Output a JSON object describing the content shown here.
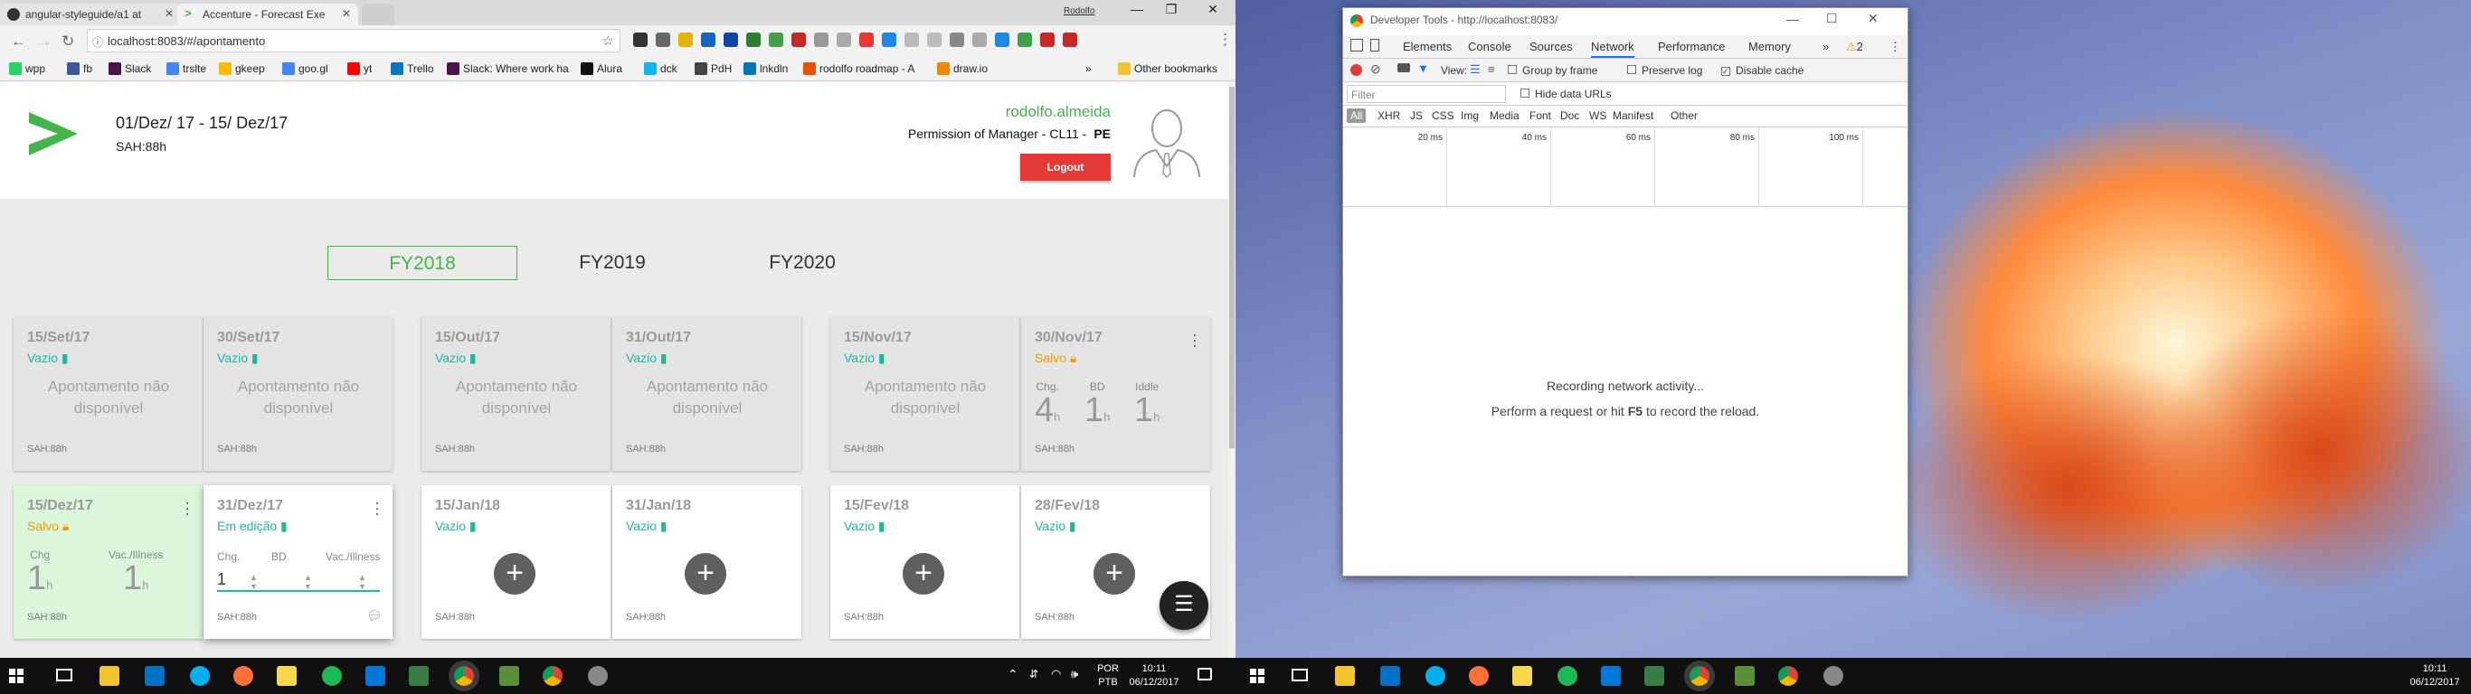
{
  "browser": {
    "tabs": [
      {
        "label": "angular-styleguide/a1 at"
      },
      {
        "label": "Accenture - Forecast Exe"
      }
    ],
    "user_label": "Rodolfo",
    "url": "localhost:8083/#/apontamento",
    "bookmarks": [
      "wpp",
      "fb",
      "Slack",
      "trslte",
      "gkeep",
      "goo.gl",
      "yt",
      "Trello",
      "Slack: Where work ha",
      "Alura",
      "dck",
      "PdH",
      "lnkdln",
      "rodolfo roadmap - A",
      "draw.io"
    ],
    "bookmarks_overflow": "»",
    "other_bookmarks": "Other bookmarks"
  },
  "header": {
    "date_range": "01/Dez/ 17 - 15/ Dez/17",
    "sah": "SAH:88h",
    "username": "rodolfo.almeida",
    "permission": "Permission of Manager - CL11 -",
    "permission_code": "PE",
    "logout": "Logout"
  },
  "fiscal_years": [
    "FY2018",
    "FY2019",
    "FY2020"
  ],
  "cards_row1": [
    {
      "date": "15/Set/17",
      "status": "Vazio",
      "msg1": "Apontamento não",
      "msg2": "disponível",
      "sah": "SAH:88h"
    },
    {
      "date": "30/Set/17",
      "status": "Vazio",
      "msg1": "Apontamento não",
      "msg2": "disponível",
      "sah": "SAH:88h"
    },
    {
      "date": "15/Out/17",
      "status": "Vazio",
      "msg1": "Apontamento não",
      "msg2": "disponível",
      "sah": "SAH:88h"
    },
    {
      "date": "31/Out/17",
      "status": "Vazio",
      "msg1": "Apontamento não",
      "msg2": "disponível",
      "sah": "SAH:88h"
    },
    {
      "date": "15/Nov/17",
      "status": "Vazio",
      "msg1": "Apontamento não",
      "msg2": "disponível",
      "sah": "SAH:88h"
    },
    {
      "date": "30/Nov/17",
      "status": "Salvo",
      "stats": [
        {
          "label": "Chg.",
          "value": "4",
          "unit": "h"
        },
        {
          "label": "BD",
          "value": "1",
          "unit": "h"
        },
        {
          "label": "Iddle",
          "value": "1",
          "unit": "h"
        }
      ],
      "sah": "SAH:88h"
    }
  ],
  "cards_row2": [
    {
      "date": "15/Dez/17",
      "status": "Salvo",
      "stats": [
        {
          "label": "Chg",
          "value": "1",
          "unit": "h"
        },
        {
          "label": "Vac./Illness",
          "value": "1",
          "unit": "h"
        }
      ],
      "sah": "SAH:88h"
    },
    {
      "date": "31/Dez/17",
      "status": "Em edição",
      "fields": [
        {
          "label": "Chg."
        },
        {
          "label": "BD"
        },
        {
          "label": "Vac./Illness"
        }
      ],
      "value": "1",
      "sah": "SAH:88h"
    },
    {
      "date": "15/Jan/18",
      "status": "Vazio",
      "sah": "SAH:88h"
    },
    {
      "date": "31/Jan/18",
      "status": "Vazio",
      "sah": "SAH:88h"
    },
    {
      "date": "15/Fev/18",
      "status": "Vazio",
      "sah": "SAH:88h"
    },
    {
      "date": "28/Fev/18",
      "status": "Vazio",
      "sah": "SAH:88h"
    }
  ],
  "devtools": {
    "title": "Developer Tools - http://localhost:8083/",
    "tabs": [
      "Elements",
      "Console",
      "Sources",
      "Network",
      "Performance",
      "Memory"
    ],
    "more": "»",
    "warnings": "2",
    "view_label": "View:",
    "group_by_frame": "Group by frame",
    "preserve_log": "Preserve log",
    "disable_cache": "Disable cache",
    "filter_placeholder": "Filter",
    "hide_data_urls": "Hide data URLs",
    "types": [
      "All",
      "XHR",
      "JS",
      "CSS",
      "Img",
      "Media",
      "Font",
      "Doc",
      "WS",
      "Manifest",
      "Other"
    ],
    "ticks": [
      "20 ms",
      "40 ms",
      "60 ms",
      "80 ms",
      "100 ms"
    ],
    "recording": "Recording network activity...",
    "hint_pre": "Perform a request or hit",
    "hint_key": "F5",
    "hint_post": "to record the reload."
  },
  "taskbar": {
    "lang1": "POR",
    "lang2": "PTB",
    "time": "10:11",
    "date": "06/12/2017"
  },
  "colors": {
    "accent": "#43b54a",
    "teal": "#1db99b",
    "orange": "#f29d00",
    "logout": "#e53935"
  }
}
